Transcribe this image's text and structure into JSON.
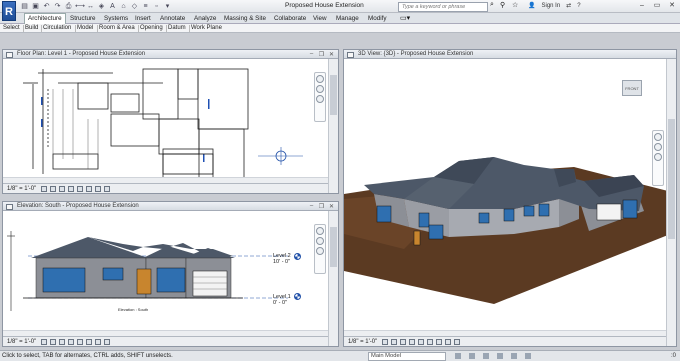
{
  "app": {
    "title": "Proposed House Extension",
    "logo_letter": "R",
    "search_placeholder": "Type a keyword or phrase",
    "signin_label": "Sign In",
    "qat_icons": [
      "open-icon",
      "save-icon",
      "undo-icon",
      "redo-icon",
      "print-icon",
      "measure-icon",
      "dimension-icon",
      "tag-icon",
      "text-icon",
      "3d-view-icon",
      "section-icon",
      "thin-lines-icon",
      "close-hidden-icon",
      "switch-windows-icon"
    ]
  },
  "ribbon": {
    "tabs": [
      "Architecture",
      "Structure",
      "Systems",
      "Insert",
      "Annotate",
      "Analyze",
      "Massing & Site",
      "Collaborate",
      "View",
      "Manage",
      "Modify"
    ],
    "active_tab": "Architecture",
    "panels": [
      "Select",
      "Build",
      "Circulation",
      "Model",
      "Room & Area",
      "Opening",
      "Datum",
      "Work Plane"
    ]
  },
  "views": {
    "floor_plan": {
      "title": "Floor Plan: Level 1 - Proposed House Extension",
      "scale": "1/8\" = 1'-0\""
    },
    "elevation": {
      "title": "Elevation: South - Proposed House Extension",
      "scale": "1/8\" = 1'-0\"",
      "level2_name": "Level 2",
      "level2_elev": "10' - 0\"",
      "level1_name": "Level 1",
      "level1_elev": "0' - 0\"",
      "caption": "Elevation : South"
    },
    "view3d": {
      "title": "3D View: {3D} - Proposed House Extension",
      "scale": "1/8\" = 1'-0\"",
      "viewcube_label": "FRONT"
    }
  },
  "status": {
    "message": "Click to select, TAB for alternates, CTRL adds, SHIFT unselects.",
    "model_value": "Main Model",
    "filter_value": ":0"
  },
  "colors": {
    "roof": "#4d5868",
    "wall": "#8c8f96",
    "window": "#2f6fb0",
    "ground": "#5b3a22"
  }
}
